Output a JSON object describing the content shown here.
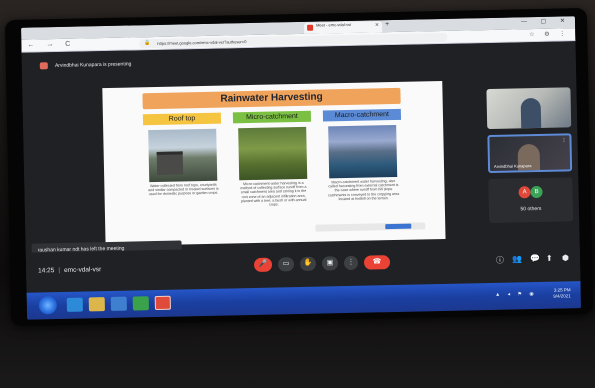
{
  "browser": {
    "tab_title": "Meet - emc-vdal-vsr",
    "url": "https://meet.google.com/emc-vdal-vsr?authuser=0",
    "new_tab_symbol": "+",
    "window_controls": "— ▢ ✕",
    "nav_symbols": "← → C",
    "lock_symbol": "🔒",
    "toolbar_symbols": "☆ ⚙ ⋮"
  },
  "meet": {
    "presenter_text": "Arvindbhai Kunapara is presenting",
    "slide": {
      "title": "Rainwater Harvesting",
      "columns": [
        {
          "heading": "Roof top",
          "description": "Water collected from roof tops, courtyards and similar compacted or treated surfaces is used for domestic purpose or garden crops."
        },
        {
          "heading": "Micro-catchment",
          "description": "Micro-catchment water harvesting is a method of collecting surface runoff from a small catchment area and storing it in the root zone of an adjacent infiltration area, planted with a tree, a bush or with annual crops."
        },
        {
          "heading": "Macro-catchment",
          "description": "Macro-catchment water harvesting, also called harvesting from external catchment is the case where runoff from hill slope catchments is conveyed to the cropping area located at foothill on the terrain."
        }
      ]
    },
    "participants": [
      {
        "name": ""
      },
      {
        "name": "Arvindbhai Kunapara"
      }
    ],
    "others_count_label": "50 others",
    "avatars": [
      "A",
      "B"
    ],
    "toast": "raushan kumar ndt has left the meeting",
    "meeting_time": "14:25",
    "meeting_code": "emc-vdal-vsr",
    "separator": "|",
    "controls": {
      "mic": "🎤",
      "camera": "▭",
      "raise_hand": "✋",
      "present": "▣",
      "more": "⋮",
      "leave": "☎"
    },
    "right_icons": [
      "ⓘ",
      "👥",
      "💬",
      "⬆",
      "⬢"
    ]
  },
  "taskbar": {
    "clock_time": "3:25 PM",
    "clock_date": "9/4/2021",
    "tray_icons": "▲ ◂ ⚑ ◉"
  },
  "colors": {
    "meet_bg": "#202124",
    "accent_red": "#ea4335",
    "slide_title_bg": "#f0a35a",
    "roof_top": "#f5c542",
    "micro_catchment": "#7bc043",
    "macro_catchment": "#5b8bd6",
    "taskbar_blue": "#1f4bb8"
  }
}
